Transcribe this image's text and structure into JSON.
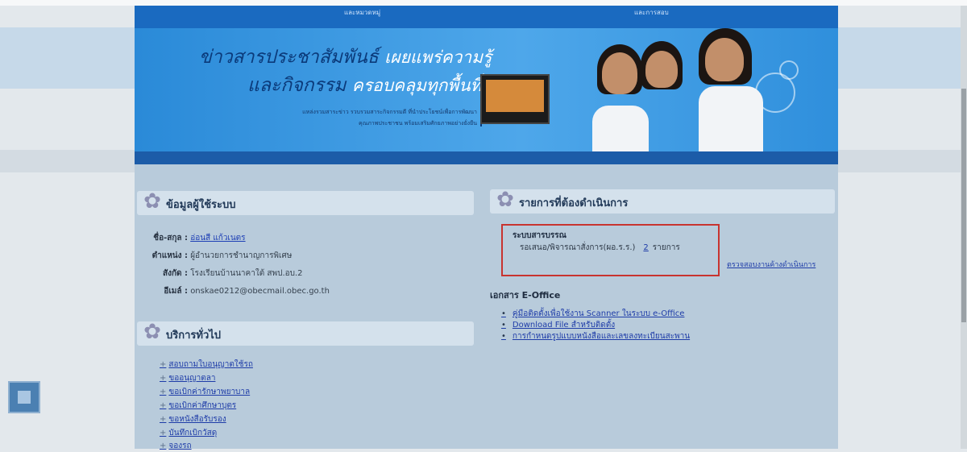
{
  "nav": {
    "items": [
      "และหมวดหมู่",
      "และการสอบ"
    ]
  },
  "banner": {
    "line1_dark": "ข่าวสารประชาสัมพันธ์",
    "line1_light": "เผยแพร่ความรู้",
    "line2_dark": "และกิจกรรม",
    "line2_light": "ครอบคลุมทุกพื้นที่",
    "small1": "แหล่งรวมสาระข่าว รวบรวมสาระกิจกรรมดี ที่นำประโยชน์เพื่อการพัฒนา",
    "small2": "คุณภาพประชาชน พร้อมเสริมศักยภาพอย่างยั่งยืน"
  },
  "user_info": {
    "title": "ข้อมูลผู้ใช้ระบบ",
    "name_label": "ชื่อ-สกุล :",
    "name_value": "อ่อนสี แก้วเนตร",
    "position_label": "ตำแหน่ง :",
    "position_value": "ผู้อำนวยการชำนาญการพิเศษ",
    "affiliation_label": "สังกัด :",
    "affiliation_value": "โรงเรียนบ้านนาคาใต้ สพป.อบ.2",
    "email_label": "อีเมล์ :",
    "email_value": "onskae0212@obecmail.obec.go.th"
  },
  "services": {
    "title": "บริการทั่วไป",
    "items": [
      "สอบถามใบอนุญาตใช้รถ",
      "ขออนุญาตลา",
      "ขอเบิกค่ารักษาพยาบาล",
      "ขอเบิกค่าศึกษาบุตร",
      "ขอหนังสือรับรอง",
      "บันทึกเบิกวัสดุ",
      "จองรถ"
    ]
  },
  "todo": {
    "title": "รายการที่ต้องดำเนินการ",
    "section": "ระบบสารบรรณ",
    "pending_label": "รอเสนอ/พิจารณาสั่งการ(ผอ.ร.ร.)",
    "pending_count": "2",
    "pending_unit": "รายการ",
    "check_link": "ตรวจสอบงานค้างดำเนินการ"
  },
  "eoffice": {
    "title": "เอกสาร E-Office",
    "items": [
      "คู่มือติดตั้งเพื่อใช้งาน Scanner ในระบบ e-Office",
      "Download File สำหรับติดตั้ง",
      "การกำหนดรูปแบบหนังสือและเลขลงทะเบียนสะพาน"
    ]
  }
}
